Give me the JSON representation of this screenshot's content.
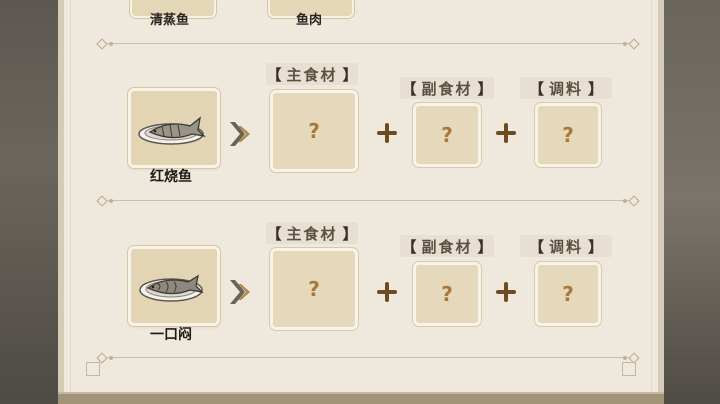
{
  "top_row": {
    "dish_label": "清蒸鱼",
    "ingredient_label": "鱼肉"
  },
  "recipes": [
    {
      "dish_name": "红烧鱼",
      "main_tag": "主食材",
      "side_tag": "副食材",
      "season_tag": "调料",
      "placeholder": "?"
    },
    {
      "dish_name": "一口闷",
      "main_tag": "主食材",
      "side_tag": "副食材",
      "season_tag": "调料",
      "placeholder": "?"
    }
  ],
  "brackets": {
    "open": "【",
    "close": "】"
  },
  "colors": {
    "panel_bg": "#efe9dd",
    "card_bg": "#e6d9bb",
    "question_mark": "#a8793c",
    "plus": "#6e4c22"
  },
  "icons": {
    "dish": "fish-plate-icon",
    "arrow": "double-chevron-right-icon",
    "plus": "plus-icon"
  }
}
